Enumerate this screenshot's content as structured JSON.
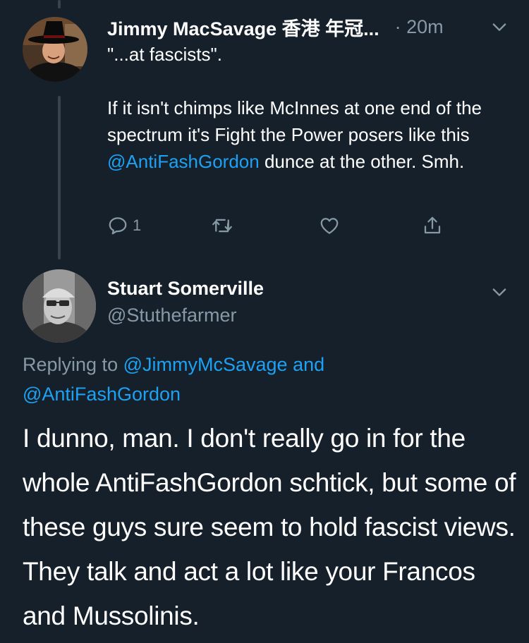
{
  "tweet1": {
    "name": "Jimmy MacSavage 香港 年冠...",
    "time": "· 20m",
    "body_line1": "\"...at fascists\".",
    "body_p2_before": "If it isn't chimps like McInnes at one end of the spectrum it's Fight the Power posers like this ",
    "body_p2_mention": "@AntiFashGordon",
    "body_p2_after": " dunce at the other. Smh.",
    "reply_count": "1",
    "icons": {
      "reply": "reply-icon",
      "retweet": "retweet-icon",
      "like": "like-icon",
      "share": "share-icon",
      "menu": "chevron-down-icon"
    }
  },
  "tweet2": {
    "name": "Stuart Somerville",
    "handle": "@Stuthefarmer",
    "replying_prefix": "Replying to ",
    "replying_mention1": "@JimmyMcSavage",
    "replying_and": " and",
    "replying_mention2": "@AntiFashGordon",
    "body": "I dunno, man.  I don't really go in for the whole AntiFashGordon schtick, but some of these guys sure seem to hold fascist views.  They talk and act a lot like your Francos and Mussolinis."
  },
  "colors": {
    "background": "#15202b",
    "text": "#ffffff",
    "secondary": "#8899a6",
    "link": "#1da1f2",
    "thread_line": "#38444d"
  }
}
